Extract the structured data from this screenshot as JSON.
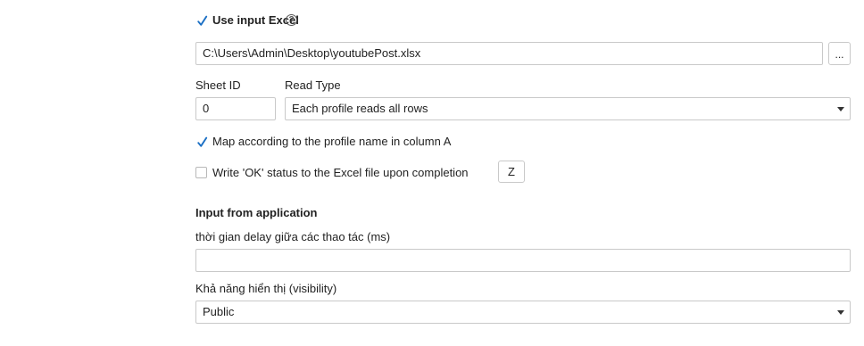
{
  "excel": {
    "use_label": "Use input Excel",
    "use_checked": true,
    "help_icon": "question-circle-icon",
    "file_path": "C:\\Users\\Admin\\Desktop\\youtubePost.xlsx",
    "browse_label": "...",
    "sheet_id_label": "Sheet ID",
    "sheet_id_value": "0",
    "read_type_label": "Read Type",
    "read_type_value": "Each profile reads all rows",
    "map_label": "Map according to the profile name in column A",
    "map_checked": true,
    "write_ok_label": "Write 'OK' status to the Excel file upon completion",
    "write_ok_checked": false,
    "write_ok_column": "Z"
  },
  "application": {
    "section_title": "Input from application",
    "delay_label": "thời gian delay giữa các thao tác (ms)",
    "delay_value": "",
    "visibility_label": "Khả năng hiển thị (visibility)",
    "visibility_value": "Public"
  },
  "colors": {
    "accent": "#1a6fc4",
    "border": "#c9c9c9"
  }
}
